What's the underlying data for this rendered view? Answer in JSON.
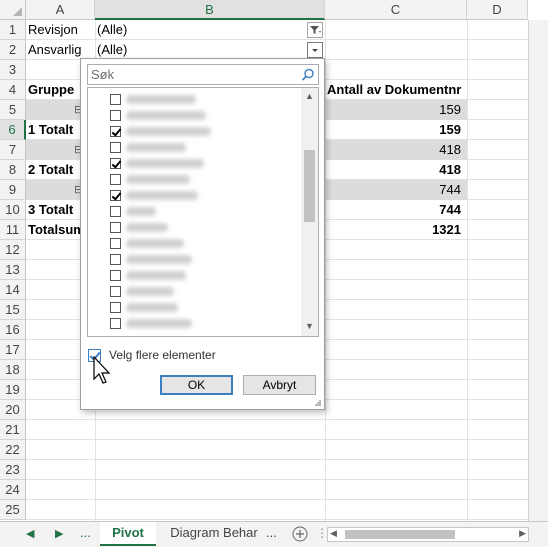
{
  "columns": [
    "A",
    "B",
    "C",
    "D"
  ],
  "rows": [
    "1",
    "2",
    "3",
    "4",
    "5",
    "6",
    "7",
    "8",
    "9",
    "10",
    "11",
    "12",
    "13",
    "14",
    "15",
    "16",
    "17",
    "18",
    "19",
    "20",
    "21",
    "22",
    "23",
    "24",
    "25"
  ],
  "filters": {
    "revisjon_label": "Revisjon",
    "revisjon_value": "(Alle)",
    "ansvarlig_label": "Ansvarlig",
    "ansvarlig_value": "(Alle)"
  },
  "pivot": {
    "header_group": "Gruppe",
    "header_count": "Antall av Dokumentnr",
    "rows": [
      {
        "label": "",
        "value": "159",
        "type": "group"
      },
      {
        "label": "1 Totalt",
        "value": "159",
        "type": "total"
      },
      {
        "label": "",
        "value": "418",
        "type": "group"
      },
      {
        "label": "2 Totalt",
        "value": "418",
        "type": "total"
      },
      {
        "label": "",
        "value": "744",
        "type": "group"
      },
      {
        "label": "3 Totalt",
        "value": "744",
        "type": "total"
      }
    ],
    "grand_total_label": "Totalsum",
    "grand_total_value": "1321"
  },
  "filter_dialog": {
    "search_placeholder": "Søk",
    "items_checked": [
      false,
      false,
      true,
      false,
      true,
      false,
      true,
      false,
      false,
      false,
      false,
      false,
      false,
      false,
      false
    ],
    "multi_select_label": "Velg flere elementer",
    "multi_select_checked": true,
    "ok_label": "OK",
    "cancel_label": "Avbryt"
  },
  "tabs": {
    "nav_ellipsis": "...",
    "active_sheet": "Pivot",
    "other_sheet": "Diagram Behar",
    "more_ellipsis": "..."
  },
  "colors": {
    "excel_green": "#217346",
    "accent_blue": "#3c7fc1"
  }
}
